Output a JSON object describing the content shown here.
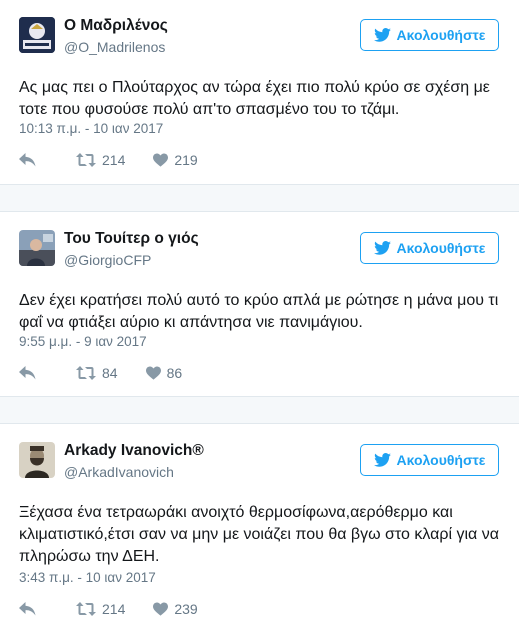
{
  "follow_label": "Ακολουθήστε",
  "colors": {
    "accent": "#1da1f2",
    "muted": "#657786",
    "icon": "#8899a6",
    "divider": "#e1e8ed",
    "gap": "#f5f8fa"
  },
  "tweets": [
    {
      "name": "Ο Μαδριλένος",
      "handle": "@O_Madrilenos",
      "avatar_icon": "real-madrid-logo",
      "text": "Ας μας πει ο Πλούταρχος αν τώρα έχει πιο πολύ κρύο σε σχέση με τοτε που φυσούσε πολύ απ'το σπασμένο του το τζάμι.",
      "timestamp": "10:13 π.μ. - 10 ιαν 2017",
      "retweets": "214",
      "likes": "219"
    },
    {
      "name": "Του Τουίτερ ο γιός",
      "handle": "@GiorgioCFP",
      "avatar_icon": "photo-avatar",
      "text": "Δεν έχει κρατήσει πολύ αυτό το κρύο απλά με ρώτησε η μάνα μου τι φαΐ να φτιάξει αύριο κι απάντησα νιε πανιμάγιου.",
      "timestamp": "9:55 μ.μ. - 9 ιαν 2017",
      "retweets": "84",
      "likes": "86"
    },
    {
      "name": "Arkady Ivanovich®",
      "handle": "@ArkadIvanovich",
      "avatar_icon": "portrait-avatar",
      "text": "Ξέχασα ένα τετραωράκι ανοιχτό θερμοσίφωνα,αερόθερμο και κλιματιστικό,έτσι σαν να μην με νοιάζει που θα βγω στο κλαρί για να πληρώσω την ΔΕΗ.",
      "timestamp": "3:43 π.μ. - 10 ιαν 2017",
      "retweets": "214",
      "likes": "239"
    }
  ]
}
